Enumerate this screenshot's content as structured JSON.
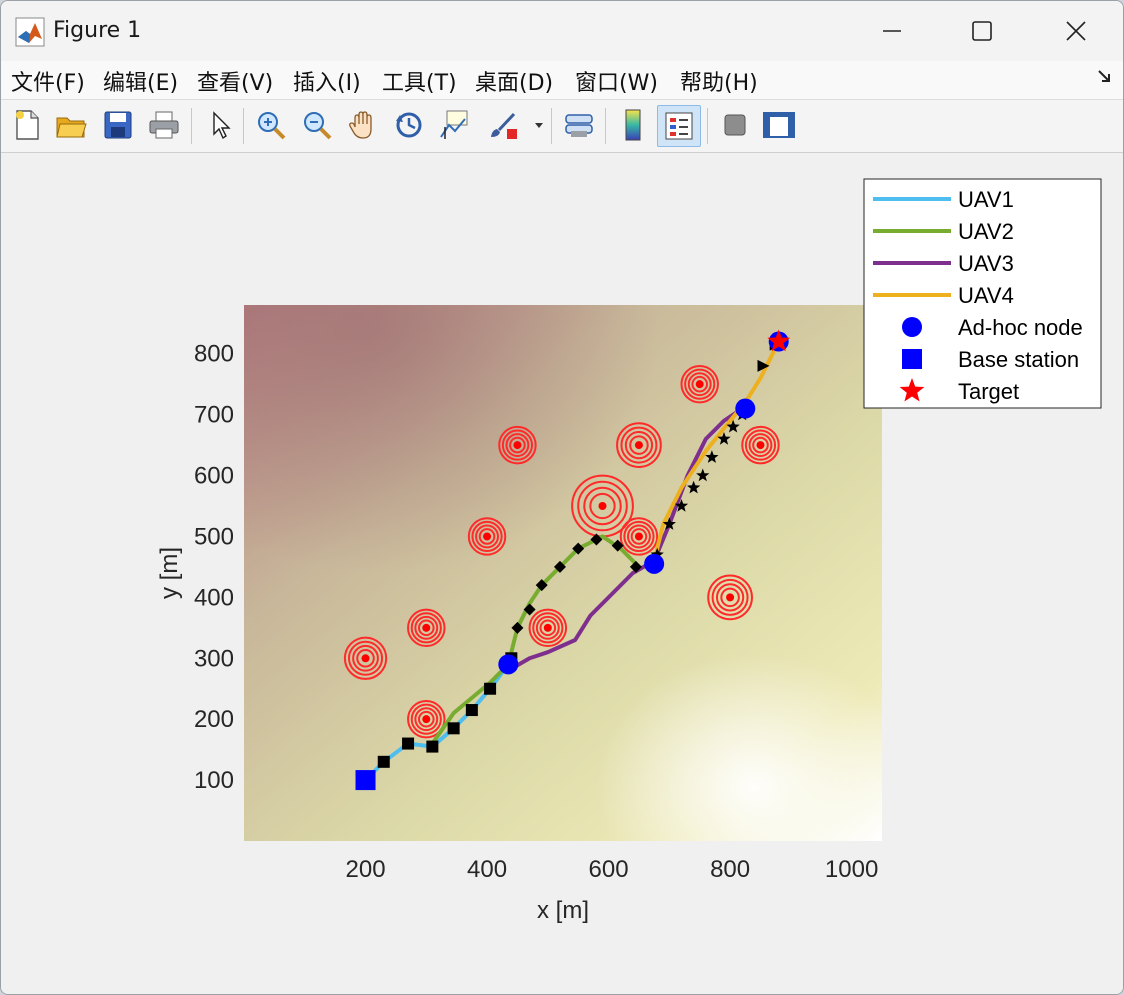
{
  "window": {
    "title": "Figure 1"
  },
  "menu": [
    "文件(F)",
    "编辑(E)",
    "查看(V)",
    "插入(I)",
    "工具(T)",
    "桌面(D)",
    "窗口(W)",
    "帮助(H)"
  ],
  "menu_dock_icon": "undock-arrow-icon",
  "toolbar_icons": [
    "new-file-icon",
    "open-folder-icon",
    "save-icon",
    "print-icon",
    "pointer-icon",
    "zoom-in-icon",
    "zoom-out-icon",
    "pan-hand-icon",
    "rotate-3d-icon",
    "data-cursor-icon",
    "brush-icon",
    "link-axes-icon",
    "colorbar-icon",
    "legend-icon",
    "hide-plot-tools-icon",
    "show-plot-tools-icon"
  ],
  "chart_data": {
    "type": "line",
    "title": "",
    "xlabel": "x [m]",
    "ylabel": "y [m]",
    "xlim": [
      0,
      1050
    ],
    "ylim": [
      0,
      880
    ],
    "xticks": [
      200,
      400,
      600,
      800,
      1000
    ],
    "yticks": [
      100,
      200,
      300,
      400,
      500,
      600,
      700,
      800
    ],
    "legend_position": "top-right",
    "series": [
      {
        "name": "UAV1",
        "color": "#4DBEEE",
        "x": [
          200,
          230,
          270,
          310,
          345,
          375,
          405,
          435
        ],
        "y": [
          100,
          130,
          160,
          155,
          185,
          215,
          250,
          290
        ]
      },
      {
        "name": "UAV2",
        "color": "#77AC30",
        "x": [
          310,
          345,
          375,
          405,
          435,
          450,
          470,
          490,
          520,
          550,
          590,
          620,
          650
        ],
        "y": [
          160,
          210,
          235,
          260,
          290,
          350,
          390,
          420,
          450,
          480,
          500,
          480,
          450
        ]
      },
      {
        "name": "UAV3",
        "color": "#7E2F8E",
        "x": [
          435,
          470,
          500,
          545,
          570,
          600,
          640,
          675,
          700,
          730,
          760,
          790,
          820
        ],
        "y": [
          280,
          300,
          310,
          330,
          370,
          400,
          440,
          460,
          520,
          600,
          660,
          690,
          710
        ]
      },
      {
        "name": "UAV4",
        "color": "#EDB120",
        "x": [
          675,
          690,
          720,
          760,
          800,
          825,
          850,
          880
        ],
        "y": [
          460,
          520,
          580,
          640,
          690,
          720,
          760,
          820
        ]
      }
    ],
    "waypoints": [
      {
        "series": "UAV1",
        "marker": "square",
        "x": [
          230,
          270,
          310,
          345,
          375,
          405,
          440
        ],
        "y": [
          130,
          160,
          155,
          185,
          215,
          250,
          300
        ]
      },
      {
        "series": "UAV2",
        "marker": "diamond",
        "x": [
          450,
          470,
          490,
          520,
          550,
          580,
          615,
          645
        ],
        "y": [
          350,
          380,
          420,
          450,
          480,
          495,
          485,
          450
        ]
      },
      {
        "series": "UAV3",
        "marker": "star",
        "x": [
          680,
          700,
          720,
          740,
          755,
          770,
          790,
          805,
          820
        ],
        "y": [
          470,
          520,
          550,
          580,
          600,
          630,
          660,
          680,
          700
        ]
      },
      {
        "series": "UAV4",
        "marker": "triangle",
        "x": [
          855,
          875
        ],
        "y": [
          780,
          815
        ]
      }
    ],
    "adhoc_nodes": {
      "name": "Ad-hoc node",
      "color": "#0000FF",
      "x": [
        435,
        675,
        825,
        880
      ],
      "y": [
        290,
        455,
        710,
        820
      ]
    },
    "base_station": {
      "name": "Base station",
      "color": "#0000FF",
      "x": [
        200
      ],
      "y": [
        100
      ]
    },
    "target": {
      "name": "Target",
      "color": "#FF0000",
      "x": [
        880
      ],
      "y": [
        820
      ]
    },
    "threats": [
      {
        "x": 200,
        "y": 300,
        "r": 34
      },
      {
        "x": 300,
        "y": 350,
        "r": 30
      },
      {
        "x": 300,
        "y": 200,
        "r": 30
      },
      {
        "x": 400,
        "y": 500,
        "r": 30
      },
      {
        "x": 450,
        "y": 650,
        "r": 30
      },
      {
        "x": 500,
        "y": 350,
        "r": 30
      },
      {
        "x": 590,
        "y": 550,
        "r": 50
      },
      {
        "x": 650,
        "y": 650,
        "r": 36
      },
      {
        "x": 650,
        "y": 500,
        "r": 30
      },
      {
        "x": 750,
        "y": 750,
        "r": 30
      },
      {
        "x": 850,
        "y": 650,
        "r": 30
      },
      {
        "x": 800,
        "y": 400,
        "r": 36
      }
    ],
    "terrain_colors": [
      "#b37d80",
      "#c8b79a",
      "#dcd9a8",
      "#eeeab8",
      "#ffffff"
    ]
  }
}
